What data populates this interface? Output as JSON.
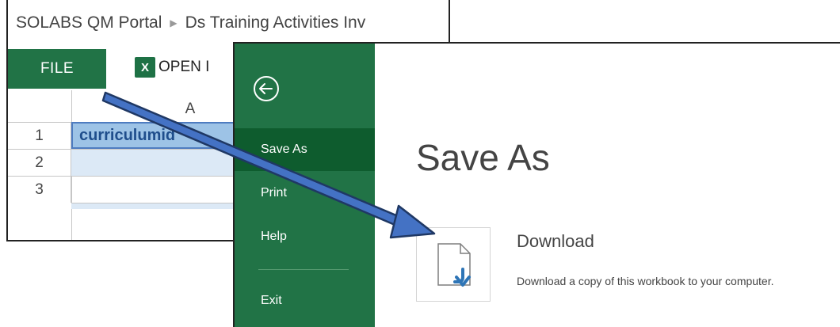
{
  "excel": {
    "breadcrumb": {
      "site": "SOLABS QM Portal",
      "separator": "▶",
      "document": "Ds Training Activities Inv"
    },
    "ribbon": {
      "file_tab": "FILE",
      "open_in_label": "OPEN I",
      "excel_icon": "excel-icon",
      "excel_icon_glyph": "X"
    },
    "grid": {
      "column_header": "A",
      "rows": [
        {
          "number": "1",
          "value": "curriculumid"
        },
        {
          "number": "2",
          "value": ""
        },
        {
          "number": "3",
          "value": ""
        }
      ]
    }
  },
  "backstage": {
    "back_icon": "back-arrow-icon",
    "nav": [
      {
        "label": "Save As",
        "selected": true
      },
      {
        "label": "Print",
        "selected": false
      },
      {
        "label": "Help",
        "selected": false
      },
      {
        "label": "Exit",
        "selected": false
      }
    ],
    "title": "Save As",
    "download": {
      "icon": "download-file-icon",
      "heading": "Download",
      "description": "Download a copy of this workbook to your computer."
    }
  },
  "colors": {
    "excel_green": "#217346",
    "nav_selected": "#0e5c2e",
    "cell_selected": "#9dc3e6",
    "arrow_fill": "#4472c4",
    "arrow_outline": "#1f3864",
    "download_arrow": "#2e75b6"
  }
}
